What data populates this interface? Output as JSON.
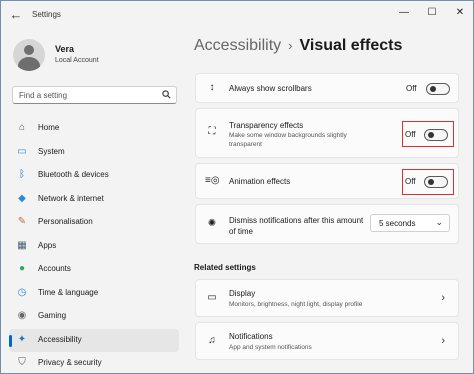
{
  "window": {
    "title": "Settings",
    "controls": {
      "minimize": "—",
      "maximize": "☐",
      "close": "✕"
    }
  },
  "user": {
    "name": "Vera",
    "account": "Local Account"
  },
  "search": {
    "placeholder": "Find a setting"
  },
  "sidebar": {
    "items": [
      {
        "label": "Home",
        "icon": "home-icon",
        "glyph": "⌂",
        "color": "#555555",
        "selected": false
      },
      {
        "label": "System",
        "icon": "system-icon",
        "glyph": "▭",
        "color": "#2b88d8",
        "selected": false
      },
      {
        "label": "Bluetooth & devices",
        "icon": "bluetooth-icon",
        "glyph": "ᛒ",
        "color": "#1a73c9",
        "selected": false
      },
      {
        "label": "Network & internet",
        "icon": "network-icon",
        "glyph": "◆",
        "color": "#2b88d8",
        "selected": false
      },
      {
        "label": "Personalisation",
        "icon": "paintbrush-icon",
        "glyph": "✎",
        "color": "#c36a3a",
        "selected": false
      },
      {
        "label": "Apps",
        "icon": "apps-icon",
        "glyph": "▦",
        "color": "#4a5a78",
        "selected": false
      },
      {
        "label": "Accounts",
        "icon": "accounts-icon",
        "glyph": "●",
        "color": "#2aa86a",
        "selected": false
      },
      {
        "label": "Time & language",
        "icon": "globe-clock-icon",
        "glyph": "◷",
        "color": "#2b88d8",
        "selected": false
      },
      {
        "label": "Gaming",
        "icon": "gaming-icon",
        "glyph": "◉",
        "color": "#666666",
        "selected": false
      },
      {
        "label": "Accessibility",
        "icon": "accessibility-icon",
        "glyph": "✦",
        "color": "#1a73c9",
        "selected": true
      },
      {
        "label": "Privacy & security",
        "icon": "shield-icon",
        "glyph": "⛉",
        "color": "#555555",
        "selected": false
      }
    ]
  },
  "breadcrumb": {
    "parent": "Accessibility",
    "separator": "›",
    "current": "Visual effects"
  },
  "settings": {
    "scrollbars": {
      "title": "Always show scrollbars",
      "state": "Off",
      "on": false
    },
    "transparency": {
      "title": "Transparency effects",
      "description": "Make some window backgrounds slightly transparent",
      "state": "Off",
      "on": false
    },
    "animation": {
      "title": "Animation effects",
      "state": "Off",
      "on": false
    },
    "notifications": {
      "title": "Dismiss notifications after this amount of time",
      "value": "5 seconds"
    }
  },
  "related": {
    "heading": "Related settings",
    "items": [
      {
        "title": "Display",
        "description": "Monitors, brightness, night light, display profile"
      },
      {
        "title": "Notifications",
        "description": "App and system notifications"
      }
    ]
  },
  "colors": {
    "accent": "#0067c0",
    "highlight": "#d9302c",
    "background": "#f3f3f3"
  }
}
